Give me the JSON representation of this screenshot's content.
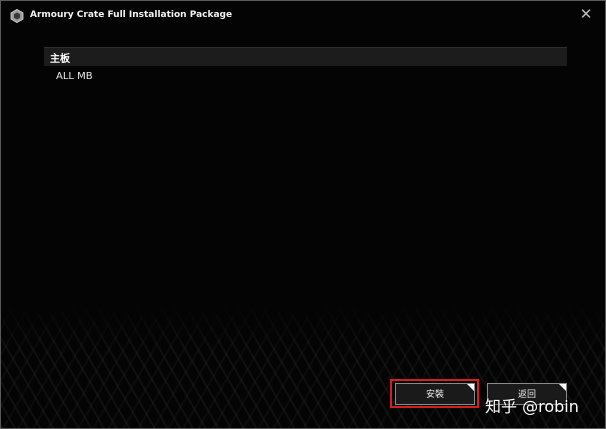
{
  "window": {
    "title": "Armoury Crate Full Installation Package",
    "close_glyph": "✕"
  },
  "section": {
    "header": "主板",
    "items": [
      "ALL MB"
    ]
  },
  "buttons": {
    "install_label": "安裝",
    "back_label": "返回"
  },
  "watermark": "知乎 @robin",
  "colors": {
    "background": "#000000",
    "highlight": "#d4201c",
    "header_bg": "#1c1c1c"
  }
}
